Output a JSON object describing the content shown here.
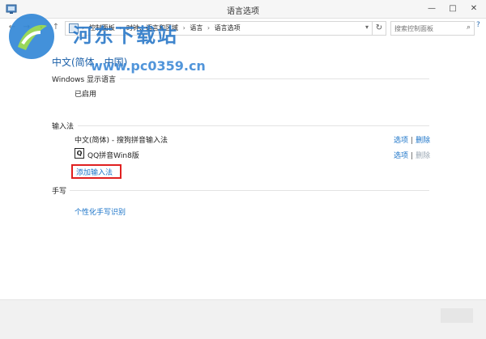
{
  "window": {
    "title": "语言选项",
    "min_glyph": "—",
    "max_glyph": "□",
    "close_glyph": "✕"
  },
  "watermark": {
    "brand": "河东下载站",
    "url": "www.pc0359.cn"
  },
  "nav": {
    "back_glyph": "←",
    "forward_glyph": "→",
    "recent_glyph": "▾",
    "up_glyph": "↑",
    "breadcrumbs": [
      "控制面板",
      "时钟、语言和区域",
      "语言",
      "语言选项"
    ],
    "breadcrumb_separator": "›",
    "dropdown_glyph": "▾",
    "refresh_glyph": "↻",
    "search_placeholder": "搜索控制面板",
    "search_glyph": "⌕",
    "help_glyph": "?"
  },
  "main": {
    "page_title": "中文(简体，中国)",
    "display_language": {
      "heading": "Windows 显示语言",
      "status": "已启用"
    },
    "input_methods": {
      "heading": "输入法",
      "items": [
        {
          "name": "中文(简体) - 搜狗拼音输入法",
          "options_label": "选项",
          "remove_label": "删除",
          "remove_enabled": true
        },
        {
          "name": "QQ拼音Win8版",
          "icon_glyph": "Q",
          "options_label": "选项",
          "remove_label": "删除",
          "remove_enabled": false
        }
      ],
      "add_label": "添加输入法"
    },
    "handwriting": {
      "heading": "手写",
      "link_label": "个性化手写识别"
    }
  },
  "colors": {
    "link": "#1a73c8",
    "title": "#1a5fa8",
    "highlight_box": "#e02020",
    "disabled": "#9aa7b3"
  }
}
